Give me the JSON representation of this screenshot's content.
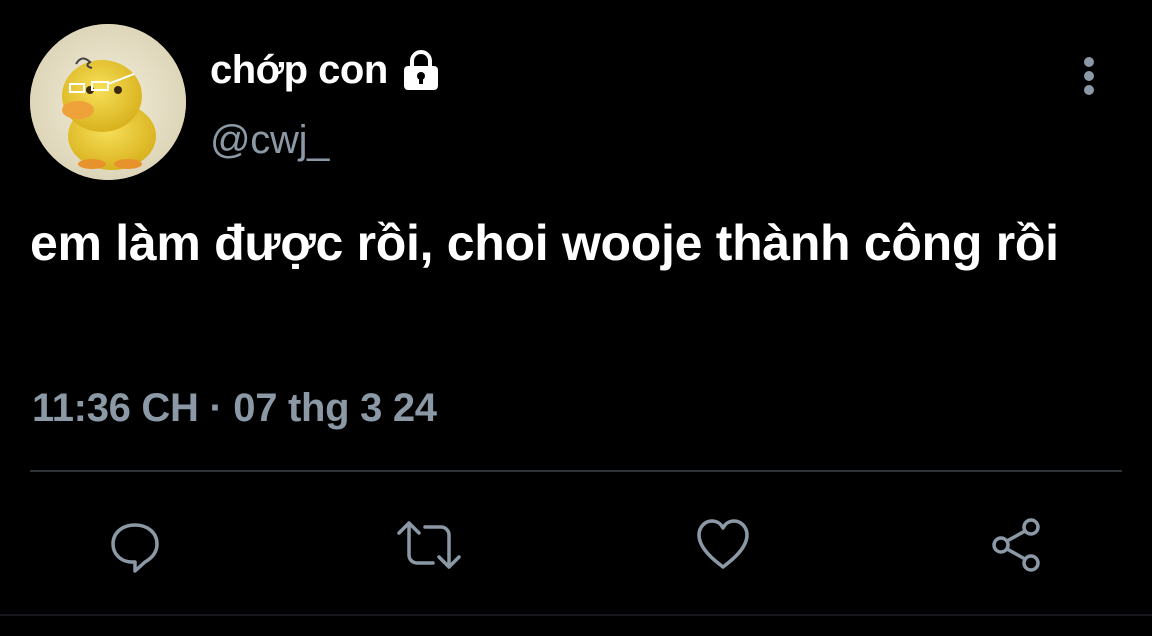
{
  "author": {
    "display_name": "chớp con",
    "handle": "@cwj_",
    "avatar": "duck-avatar",
    "protected_icon": "lock-icon"
  },
  "tweet": {
    "text": "em làm được rồi, choi wooje thành công rồi",
    "time": "11:36 CH",
    "separator": "·",
    "date": "07 thg 3 24"
  },
  "actions": {
    "more": "more-vertical-icon",
    "reply": "reply-icon",
    "retweet": "retweet-icon",
    "like": "heart-icon",
    "share": "share-icon"
  },
  "colors": {
    "background": "#000000",
    "primary_text": "#ffffff",
    "secondary_text": "#8b98a5",
    "divider": "#2f3336"
  }
}
